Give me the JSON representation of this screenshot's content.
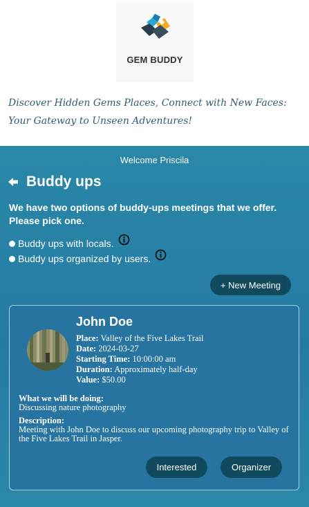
{
  "brand": {
    "name": "GEM BUDDY"
  },
  "tagline": "Discover Hidden Gems Places, Connect with New Faces: Your Gateway to Unseen Adventures!",
  "welcome": "Welcome Priscila",
  "page": {
    "title": "Buddy ups"
  },
  "intro": "We have two options of buddy-ups meetings that we offer. Please pick one.",
  "options": [
    {
      "label": "Buddy ups with locals."
    },
    {
      "label": "Buddy ups organized by users."
    }
  ],
  "new_meeting_label": "+ New Meeting",
  "meeting": {
    "name": "John Doe",
    "place_label": "Place:",
    "place": "Valley of the Five Lakes Trail",
    "date_label": "Date:",
    "date": "2024-03-27",
    "time_label": "Starting Time:",
    "time": "10:00:00 am",
    "duration_label": "Duration:",
    "duration": "Approximately half-day",
    "value_label": "Value:",
    "value": "$50.00",
    "doing_label": "What we will be doing:",
    "doing": "Discussing nature photography",
    "description_label": "Description:",
    "description": "Meeting with John Doe to discuss our upcoming photography trip to Valley of the Five Lakes Trail in Jasper."
  },
  "buttons": {
    "interested": "Interested",
    "organizer": "Organizer"
  },
  "colors": {
    "panel": "#257aa3",
    "button": "#114a5e",
    "tagline": "#2f5d73"
  }
}
